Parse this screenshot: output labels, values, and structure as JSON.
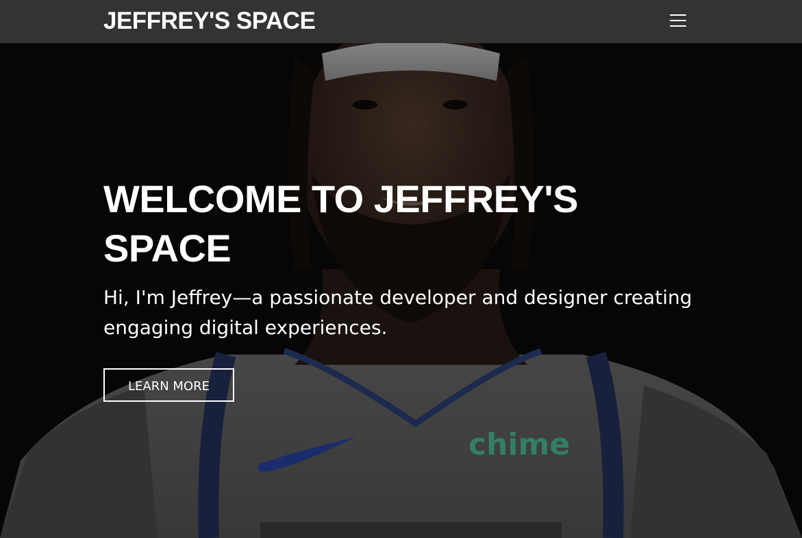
{
  "navbar": {
    "brand": "JEFFREY'S SPACE",
    "menu_icon": "hamburger-menu-icon"
  },
  "hero": {
    "title": "WELCOME TO JEFFREY'S SPACE",
    "subtitle": "Hi, I'm Jeffrey—a passionate developer and designer creating engaging digital experiences.",
    "cta_label": "LEARN MORE",
    "background_image": "basketball player portrait in white jersey",
    "jersey_sponsor": "chime"
  },
  "colors": {
    "navbar_bg": "#333333",
    "text": "#ffffff",
    "hero_bg": "#0b0b0b",
    "jersey": "#c9c9c9",
    "jersey_trim": "#1b3a8a",
    "sponsor": "#2f8f6d"
  }
}
